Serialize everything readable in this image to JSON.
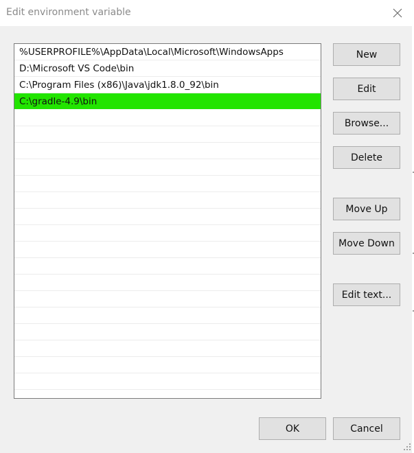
{
  "window": {
    "title": "Edit environment variable",
    "close_icon": "close-icon"
  },
  "paths": [
    {
      "value": "%USERPROFILE%\\AppData\\Local\\Microsoft\\WindowsApps",
      "selected": false
    },
    {
      "value": "D:\\Microsoft VS Code\\bin",
      "selected": false
    },
    {
      "value": "C:\\Program Files (x86)\\Java\\jdk1.8.0_92\\bin",
      "selected": false
    },
    {
      "value": "C:\\gradle-4.9\\bin",
      "selected": true
    }
  ],
  "buttons": {
    "new": "New",
    "edit": "Edit",
    "browse": "Browse...",
    "delete": "Delete",
    "move_up": "Move Up",
    "move_down": "Move Down",
    "edit_text": "Edit text...",
    "ok": "OK",
    "cancel": "Cancel"
  },
  "colors": {
    "selection": "#22e400",
    "window_bg": "#f0f0f0",
    "title_text": "#8a8a8a"
  }
}
